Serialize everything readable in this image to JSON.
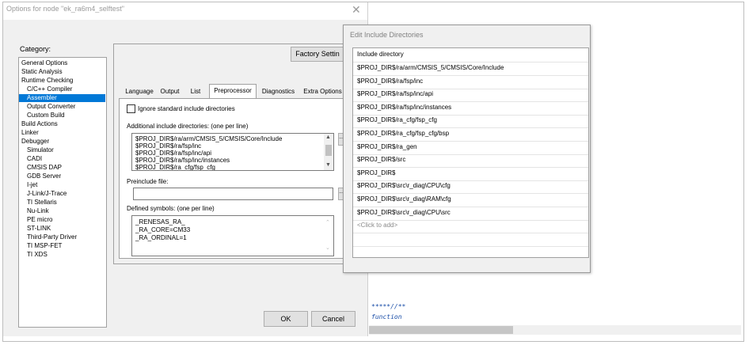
{
  "options_dialog": {
    "title": "Options for node \"ek_ra6m4_selftest\"",
    "close_glyph": "✕",
    "category_label": "Category:",
    "categories": [
      {
        "label": "General Options",
        "indent": false,
        "selected": false
      },
      {
        "label": "Static Analysis",
        "indent": false,
        "selected": false
      },
      {
        "label": "Runtime Checking",
        "indent": false,
        "selected": false
      },
      {
        "label": "C/C++ Compiler",
        "indent": true,
        "selected": false
      },
      {
        "label": "Assembler",
        "indent": true,
        "selected": true
      },
      {
        "label": "Output Converter",
        "indent": true,
        "selected": false
      },
      {
        "label": "Custom Build",
        "indent": true,
        "selected": false
      },
      {
        "label": "Build Actions",
        "indent": false,
        "selected": false
      },
      {
        "label": "Linker",
        "indent": false,
        "selected": false
      },
      {
        "label": "Debugger",
        "indent": false,
        "selected": false
      },
      {
        "label": "Simulator",
        "indent": true,
        "selected": false
      },
      {
        "label": "CADI",
        "indent": true,
        "selected": false
      },
      {
        "label": "CMSIS DAP",
        "indent": true,
        "selected": false
      },
      {
        "label": "GDB Server",
        "indent": true,
        "selected": false
      },
      {
        "label": "I-jet",
        "indent": true,
        "selected": false
      },
      {
        "label": "J-Link/J-Trace",
        "indent": true,
        "selected": false
      },
      {
        "label": "TI Stellaris",
        "indent": true,
        "selected": false
      },
      {
        "label": "Nu-Link",
        "indent": true,
        "selected": false
      },
      {
        "label": "PE micro",
        "indent": true,
        "selected": false
      },
      {
        "label": "ST-LINK",
        "indent": true,
        "selected": false
      },
      {
        "label": "Third-Party Driver",
        "indent": true,
        "selected": false
      },
      {
        "label": "TI MSP-FET",
        "indent": true,
        "selected": false
      },
      {
        "label": "TI XDS",
        "indent": true,
        "selected": false
      }
    ],
    "factory_settings_label": "Factory Settin",
    "tabs": [
      "Language",
      "Output",
      "List",
      "Preprocessor",
      "Diagnostics",
      "Extra Options"
    ],
    "active_tab": "Preprocessor",
    "ignore_std_label": "Ignore standard include directories",
    "ignore_std_checked": false,
    "include_dirs_label": "Additional include directories: (one per line)",
    "include_dirs_lines": [
      "$PROJ_DIR$/ra/arm/CMSIS_5/CMSIS/Core/Include",
      "$PROJ_DIR$/ra/fsp/inc",
      "$PROJ_DIR$/ra/fsp/inc/api",
      "$PROJ_DIR$/ra/fsp/inc/instances",
      "$PROJ_DIR$/ra_cfg/fsp_cfg"
    ],
    "preinclude_label": "Preinclude file:",
    "preinclude_value": "",
    "defined_symbols_label": "Defined symbols: (one per line)",
    "defined_symbols_lines": [
      "_RENESAS_RA_",
      "_RA_CORE=CM33",
      "_RA_ORDINAL=1"
    ],
    "ok_label": "OK",
    "cancel_label": "Cancel",
    "browse_label": "..."
  },
  "include_dialog": {
    "title": "Edit Include Directories",
    "header": "Include directory",
    "rows": [
      "$PROJ_DIR$/ra/arm/CMSIS_5/CMSIS/Core/Include",
      "$PROJ_DIR$/ra/fsp/inc",
      "$PROJ_DIR$/ra/fsp/inc/api",
      "$PROJ_DIR$/ra/fsp/inc/instances",
      "$PROJ_DIR$/ra_cfg/fsp_cfg",
      "$PROJ_DIR$/ra_cfg/fsp_cfg/bsp",
      "$PROJ_DIR$/ra_gen",
      "$PROJ_DIR$/src",
      "$PROJ_DIR$",
      "$PROJ_DIR$\\src\\r_diag\\CPU\\cfg",
      "$PROJ_DIR$\\src\\r_diag\\RAM\\cfg",
      "$PROJ_DIR$\\src\\r_diag\\CPU\\src"
    ],
    "add_placeholder": "<Click to add>"
  },
  "editor": {
    "line1": "*****//**",
    "line2": "function"
  }
}
